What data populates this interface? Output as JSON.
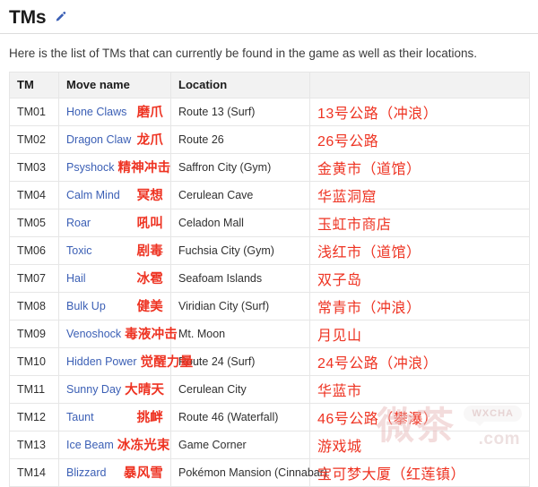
{
  "header": {
    "title": "TMs",
    "edit_icon": "pencil-edit-icon"
  },
  "intro": "Here is the list of TMs that can currently be found in the game as well as their locations.",
  "table": {
    "columns": [
      "TM",
      "Move name",
      "Location"
    ],
    "rows": [
      {
        "tm": "TM01",
        "move_en": "Hone Claws",
        "move_zh": "磨爪",
        "location_en": "Route 13 (Surf)",
        "location_zh": "13号公路（冲浪）"
      },
      {
        "tm": "TM02",
        "move_en": "Dragon Claw",
        "move_zh": "龙爪",
        "location_en": "Route 26",
        "location_zh": "26号公路"
      },
      {
        "tm": "TM03",
        "move_en": "Psyshock",
        "move_zh": "精神冲击",
        "location_en": "Saffron City (Gym)",
        "location_zh": "金黄市（道馆）"
      },
      {
        "tm": "TM04",
        "move_en": "Calm Mind",
        "move_zh": "冥想",
        "location_en": "Cerulean Cave",
        "location_zh": "华蓝洞窟"
      },
      {
        "tm": "TM05",
        "move_en": "Roar",
        "move_zh": "吼叫",
        "location_en": "Celadon Mall",
        "location_zh": "玉虹市商店"
      },
      {
        "tm": "TM06",
        "move_en": "Toxic",
        "move_zh": "剧毒",
        "location_en": "Fuchsia City (Gym)",
        "location_zh": "浅红市（道馆）"
      },
      {
        "tm": "TM07",
        "move_en": "Hail",
        "move_zh": "冰雹",
        "location_en": "Seafoam Islands",
        "location_zh": "双子岛"
      },
      {
        "tm": "TM08",
        "move_en": "Bulk Up",
        "move_zh": "健美",
        "location_en": "Viridian City (Surf)",
        "location_zh": "常青市（冲浪）"
      },
      {
        "tm": "TM09",
        "move_en": "Venoshock",
        "move_zh": "毒液冲击",
        "location_en": "Mt. Moon",
        "location_zh": "月见山"
      },
      {
        "tm": "TM10",
        "move_en": "Hidden Power",
        "move_zh": "觉醒力量",
        "location_en": "Route 24 (Surf)",
        "location_zh": "24号公路（冲浪）"
      },
      {
        "tm": "TM11",
        "move_en": "Sunny Day",
        "move_zh": "大晴天",
        "location_en": "Cerulean City",
        "location_zh": "华蓝市"
      },
      {
        "tm": "TM12",
        "move_en": "Taunt",
        "move_zh": "挑衅",
        "location_en": "Route 46 (Waterfall)",
        "location_zh": "46号公路（攀瀑）"
      },
      {
        "tm": "TM13",
        "move_en": "Ice Beam",
        "move_zh": "冰冻光束",
        "location_en": "Game Corner",
        "location_zh": "游戏城"
      },
      {
        "tm": "TM14",
        "move_en": "Blizzard",
        "move_zh": "暴风雪",
        "location_en": "Pokémon Mansion (Cinnabar)",
        "location_zh": "宝可梦大厦（红莲镇）"
      }
    ]
  },
  "watermark": {
    "chars": "微茶",
    "bubble": "WXCHA",
    "dotcom": ".com"
  },
  "colors": {
    "link_blue": "#3b5fb5",
    "annotation_red": "#ee3322",
    "header_bg": "#f2f2f2"
  }
}
